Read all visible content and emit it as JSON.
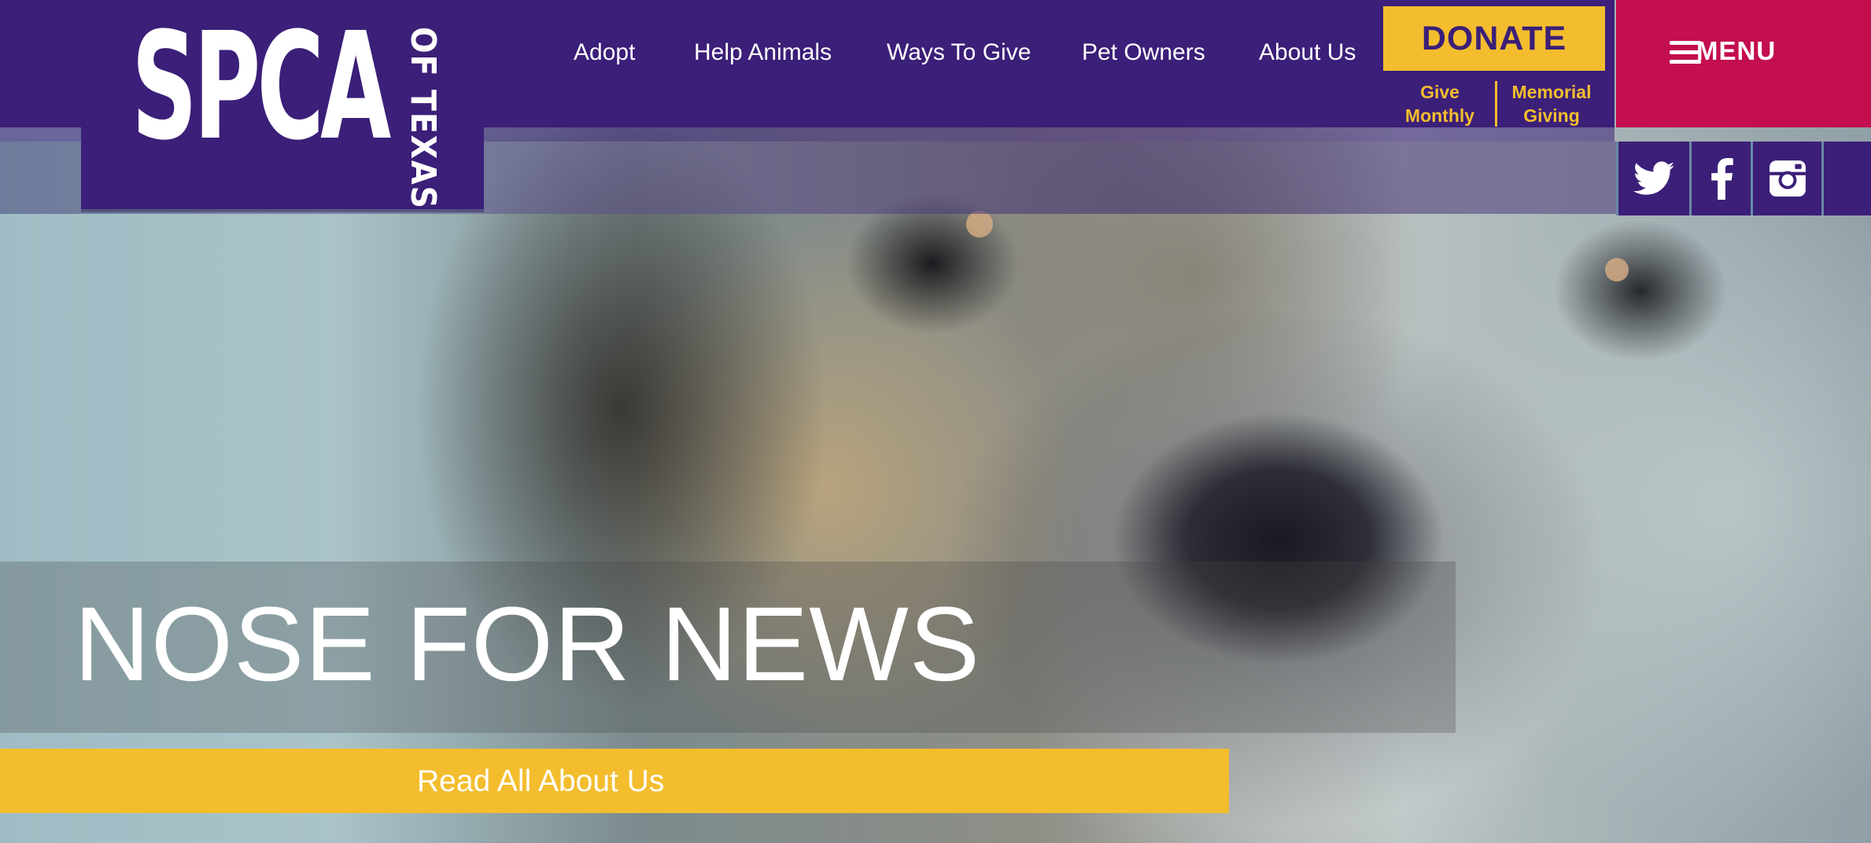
{
  "brand": {
    "logo_main": "SPCA",
    "logo_sub": "OF TEXAS",
    "primary_color": "#3b1f78",
    "accent_color": "#f3bd2e",
    "menu_color": "#c30e4f"
  },
  "nav": {
    "items": [
      {
        "label": "Adopt"
      },
      {
        "label": "Help Animals"
      },
      {
        "label": "Ways To Give"
      },
      {
        "label": "Pet Owners"
      },
      {
        "label": "About Us"
      }
    ]
  },
  "donate": {
    "label": "DONATE",
    "give_monthly": [
      "Give",
      "Monthly"
    ],
    "memorial_giving": [
      "Memorial",
      "Giving"
    ]
  },
  "menu": {
    "label": "MENU",
    "icon": "hamburger-icon"
  },
  "social": {
    "icons": [
      "twitter-icon",
      "facebook-icon",
      "instagram-icon"
    ]
  },
  "hero": {
    "headline": "NOSE FOR NEWS",
    "cta_label": "Read All About Us"
  }
}
